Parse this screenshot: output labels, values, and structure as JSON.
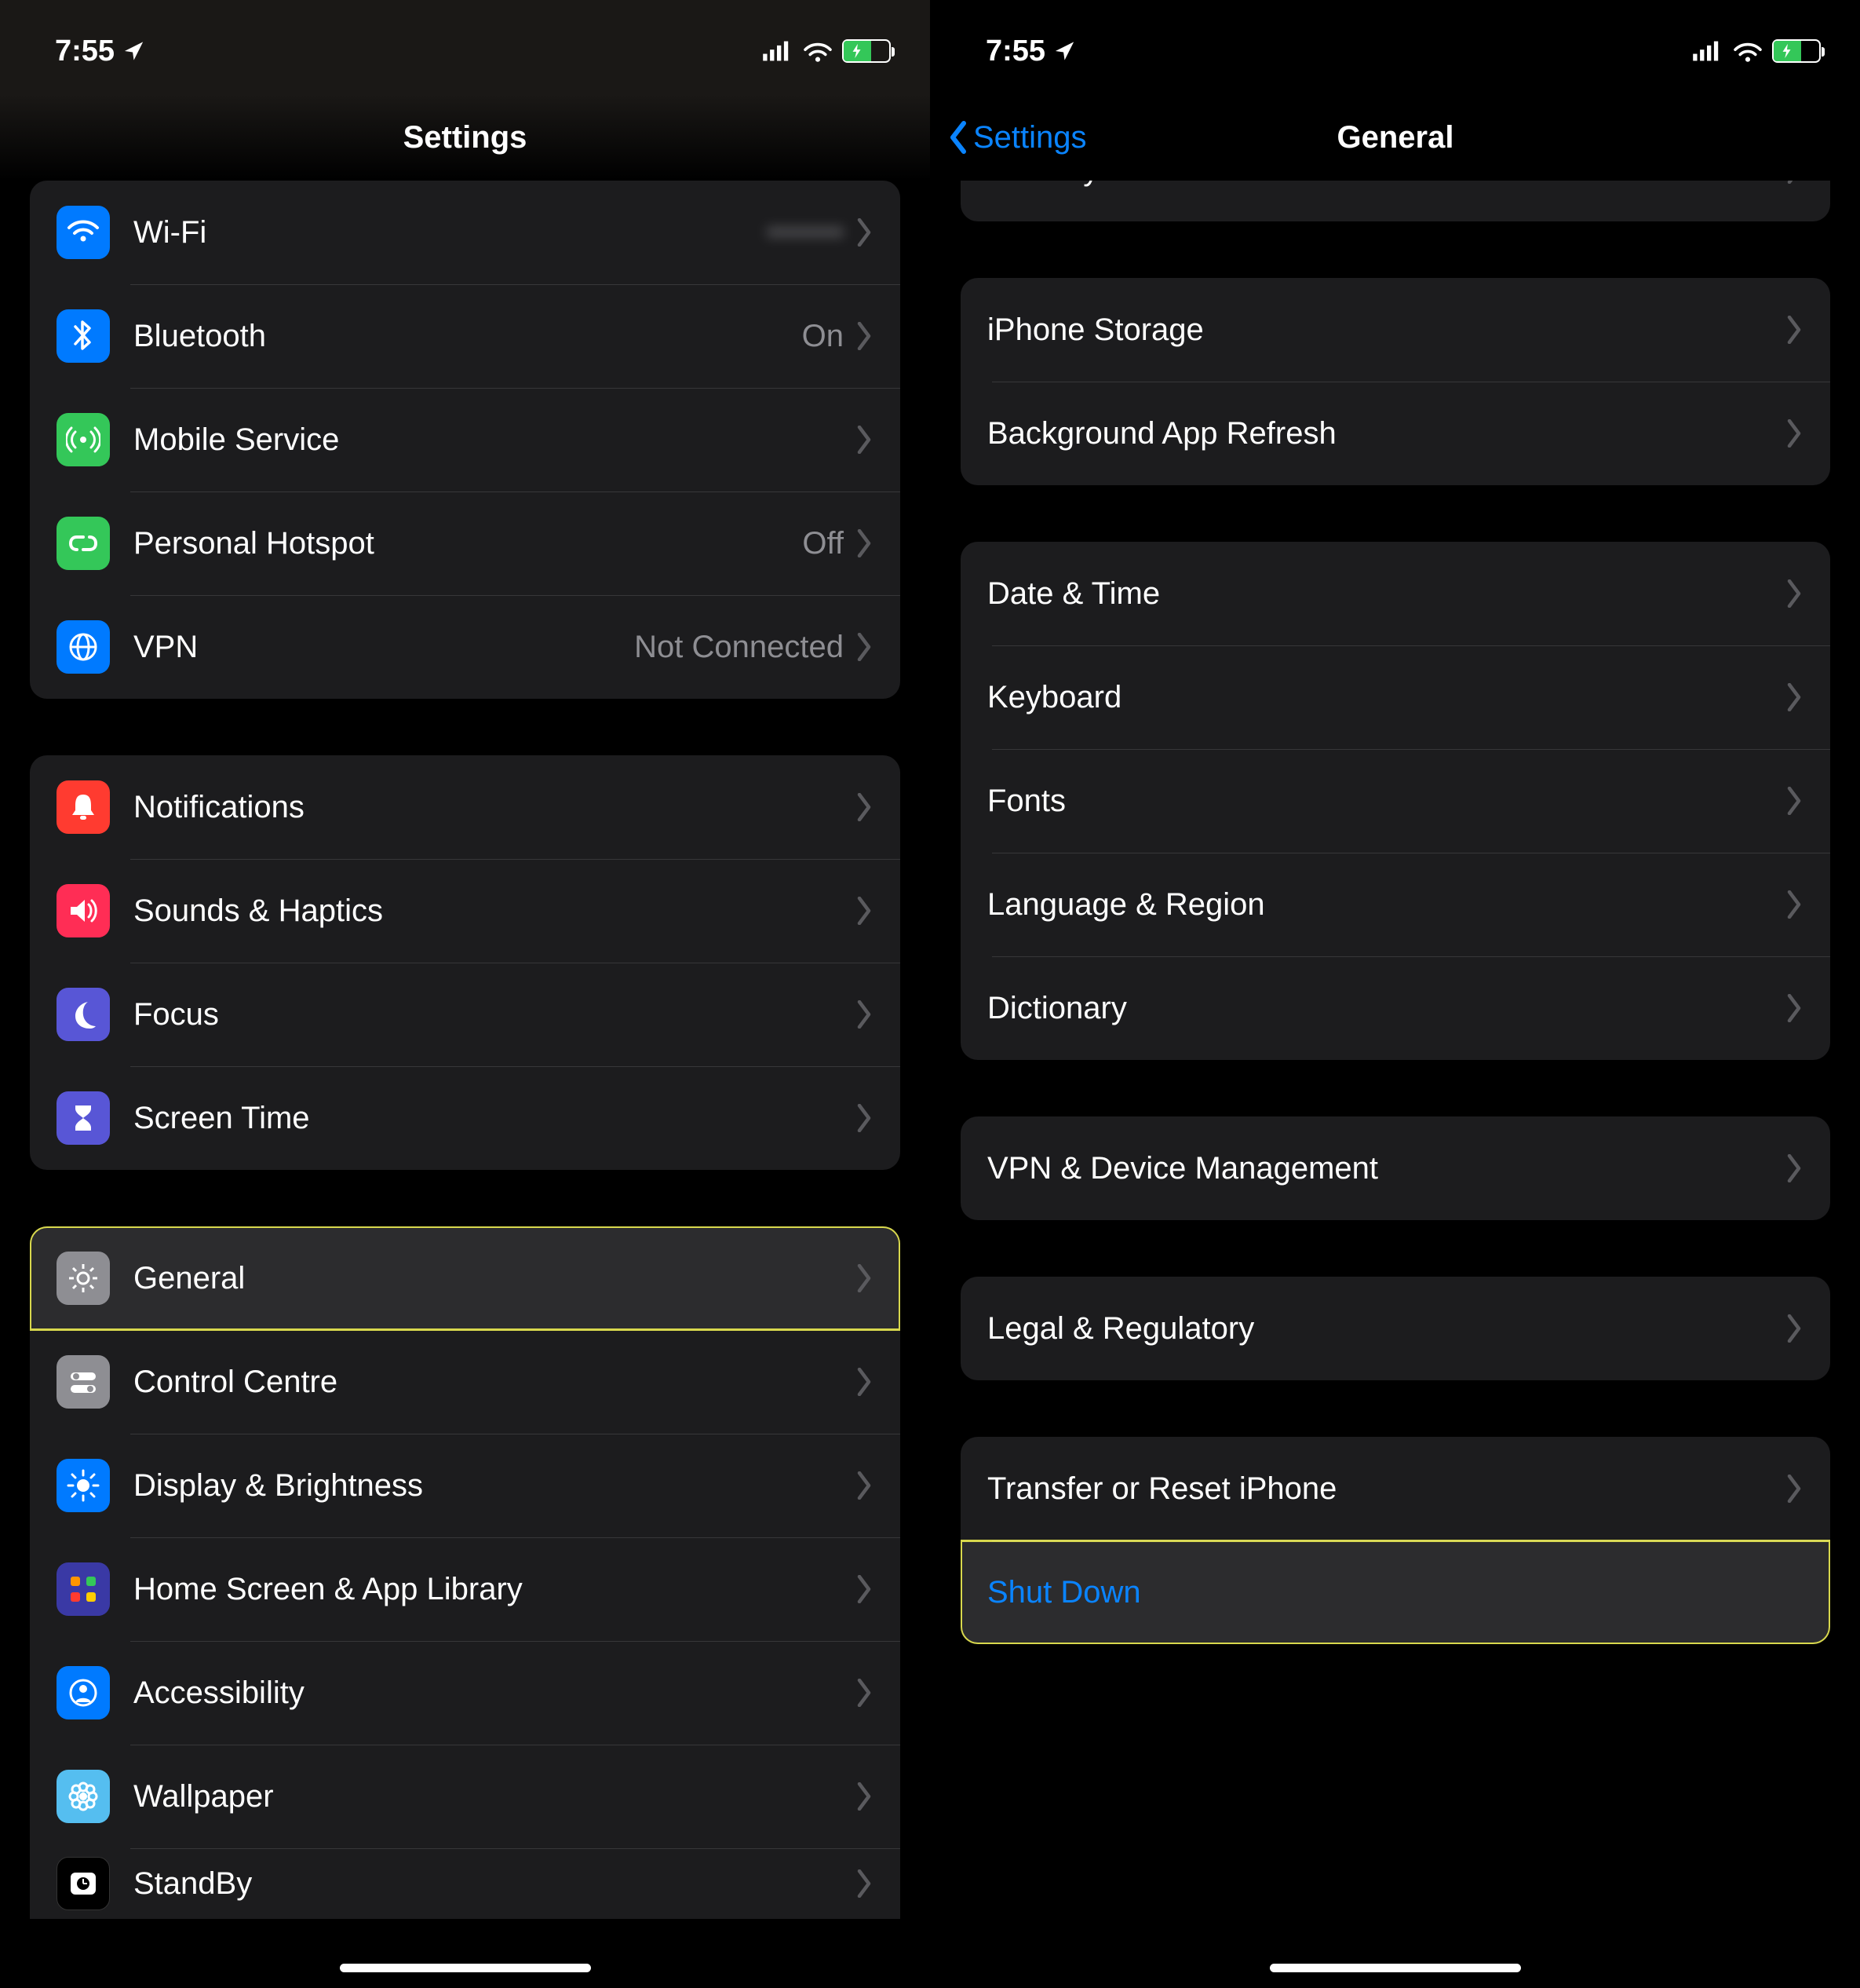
{
  "status": {
    "time": "7:55",
    "location_arrow": true
  },
  "screen1": {
    "title": "Settings",
    "groups": [
      {
        "rows": [
          {
            "icon": "wifi",
            "color": "#007aff",
            "label": "Wi-Fi",
            "value": "•••••••",
            "blurred": true
          },
          {
            "icon": "bluetooth",
            "color": "#007aff",
            "label": "Bluetooth",
            "value": "On"
          },
          {
            "icon": "antenna",
            "color": "#34c759",
            "label": "Mobile Service",
            "value": ""
          },
          {
            "icon": "link",
            "color": "#34c759",
            "label": "Personal Hotspot",
            "value": "Off"
          },
          {
            "icon": "globe",
            "color": "#007aff",
            "label": "VPN",
            "value": "Not Connected"
          }
        ]
      },
      {
        "rows": [
          {
            "icon": "bell",
            "color": "#ff3b30",
            "label": "Notifications"
          },
          {
            "icon": "speaker",
            "color": "#ff2d55",
            "label": "Sounds & Haptics"
          },
          {
            "icon": "moon",
            "color": "#5856d6",
            "label": "Focus"
          },
          {
            "icon": "hourglass",
            "color": "#5856d6",
            "label": "Screen Time"
          }
        ]
      },
      {
        "rows": [
          {
            "icon": "gear",
            "color": "#8e8e93",
            "label": "General",
            "highlighted": true
          },
          {
            "icon": "switches",
            "color": "#8e8e93",
            "label": "Control Centre"
          },
          {
            "icon": "sun",
            "color": "#007aff",
            "label": "Display & Brightness"
          },
          {
            "icon": "grid",
            "color": "#5756ce",
            "label": "Home Screen & App Library"
          },
          {
            "icon": "person",
            "color": "#007aff",
            "label": "Accessibility"
          },
          {
            "icon": "flower",
            "color": "#55bef0",
            "label": "Wallpaper"
          },
          {
            "icon": "clock",
            "color": "#000000",
            "label": "StandBy",
            "cut": true
          }
        ]
      }
    ]
  },
  "screen2": {
    "back": "Settings",
    "title": "General",
    "groups": [
      {
        "partialTop": true,
        "rows": [
          {
            "label": "CarPlay"
          }
        ]
      },
      {
        "rows": [
          {
            "label": "iPhone Storage"
          },
          {
            "label": "Background App Refresh"
          }
        ]
      },
      {
        "rows": [
          {
            "label": "Date & Time"
          },
          {
            "label": "Keyboard"
          },
          {
            "label": "Fonts"
          },
          {
            "label": "Language & Region"
          },
          {
            "label": "Dictionary"
          }
        ]
      },
      {
        "rows": [
          {
            "label": "VPN & Device Management"
          }
        ]
      },
      {
        "rows": [
          {
            "label": "Legal & Regulatory"
          }
        ]
      },
      {
        "rows": [
          {
            "label": "Transfer or Reset iPhone"
          },
          {
            "label": "Shut Down",
            "action": true,
            "highlighted": true,
            "noChevron": true
          }
        ]
      }
    ]
  }
}
